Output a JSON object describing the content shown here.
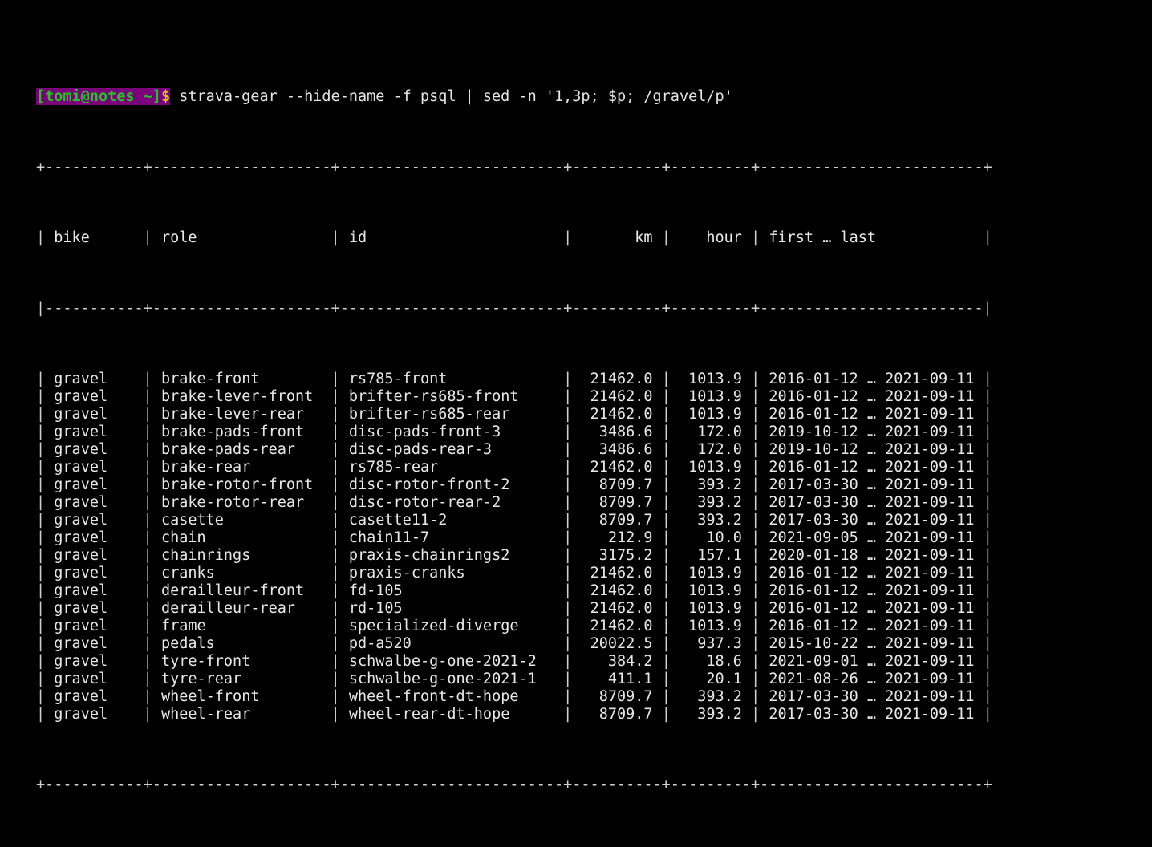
{
  "terminal": {
    "background_color": "#000000",
    "foreground_color": "#d8d8d8",
    "prompt_background_color": "#7b007b",
    "prompt_text_color": "#1fc61f",
    "prompt_dollar_color": "#cdcd00"
  },
  "prompt": {
    "user_host": "[tomi@notes ~]",
    "sigil": "$",
    "command": "strava-gear --hide-name -f psql | sed -n '1,3p; $p; /gravel/p'"
  },
  "table": {
    "top_border": "+-----------+--------------------+-------------------------+----------+---------+-------------------------+",
    "header_sep": "|-----------+--------------------+-------------------------+----------+---------+-------------------------|",
    "bottom_border": "+-----------+--------------------+-------------------------+----------+---------+-------------------------+",
    "columns": [
      {
        "key": "bike",
        "label": "bike",
        "width": 9,
        "align": "left"
      },
      {
        "key": "role",
        "label": "role",
        "width": 18,
        "align": "left"
      },
      {
        "key": "id",
        "label": "id",
        "width": 23,
        "align": "left"
      },
      {
        "key": "km",
        "label": "km",
        "width": 8,
        "align": "right"
      },
      {
        "key": "hour",
        "label": "hour",
        "width": 7,
        "align": "right"
      },
      {
        "key": "range",
        "label": "first … last",
        "width": 23,
        "align": "left"
      }
    ],
    "rows": [
      {
        "bike": "gravel",
        "role": "brake-front",
        "id": "rs785-front",
        "km": "21462.0",
        "hour": "1013.9",
        "first": "2016-01-12",
        "last": "2021-09-11"
      },
      {
        "bike": "gravel",
        "role": "brake-lever-front",
        "id": "brifter-rs685-front",
        "km": "21462.0",
        "hour": "1013.9",
        "first": "2016-01-12",
        "last": "2021-09-11"
      },
      {
        "bike": "gravel",
        "role": "brake-lever-rear",
        "id": "brifter-rs685-rear",
        "km": "21462.0",
        "hour": "1013.9",
        "first": "2016-01-12",
        "last": "2021-09-11"
      },
      {
        "bike": "gravel",
        "role": "brake-pads-front",
        "id": "disc-pads-front-3",
        "km": "3486.6",
        "hour": "172.0",
        "first": "2019-10-12",
        "last": "2021-09-11"
      },
      {
        "bike": "gravel",
        "role": "brake-pads-rear",
        "id": "disc-pads-rear-3",
        "km": "3486.6",
        "hour": "172.0",
        "first": "2019-10-12",
        "last": "2021-09-11"
      },
      {
        "bike": "gravel",
        "role": "brake-rear",
        "id": "rs785-rear",
        "km": "21462.0",
        "hour": "1013.9",
        "first": "2016-01-12",
        "last": "2021-09-11"
      },
      {
        "bike": "gravel",
        "role": "brake-rotor-front",
        "id": "disc-rotor-front-2",
        "km": "8709.7",
        "hour": "393.2",
        "first": "2017-03-30",
        "last": "2021-09-11"
      },
      {
        "bike": "gravel",
        "role": "brake-rotor-rear",
        "id": "disc-rotor-rear-2",
        "km": "8709.7",
        "hour": "393.2",
        "first": "2017-03-30",
        "last": "2021-09-11"
      },
      {
        "bike": "gravel",
        "role": "casette",
        "id": "casette11-2",
        "km": "8709.7",
        "hour": "393.2",
        "first": "2017-03-30",
        "last": "2021-09-11"
      },
      {
        "bike": "gravel",
        "role": "chain",
        "id": "chain11-7",
        "km": "212.9",
        "hour": "10.0",
        "first": "2021-09-05",
        "last": "2021-09-11"
      },
      {
        "bike": "gravel",
        "role": "chainrings",
        "id": "praxis-chainrings2",
        "km": "3175.2",
        "hour": "157.1",
        "first": "2020-01-18",
        "last": "2021-09-11"
      },
      {
        "bike": "gravel",
        "role": "cranks",
        "id": "praxis-cranks",
        "km": "21462.0",
        "hour": "1013.9",
        "first": "2016-01-12",
        "last": "2021-09-11"
      },
      {
        "bike": "gravel",
        "role": "derailleur-front",
        "id": "fd-105",
        "km": "21462.0",
        "hour": "1013.9",
        "first": "2016-01-12",
        "last": "2021-09-11"
      },
      {
        "bike": "gravel",
        "role": "derailleur-rear",
        "id": "rd-105",
        "km": "21462.0",
        "hour": "1013.9",
        "first": "2016-01-12",
        "last": "2021-09-11"
      },
      {
        "bike": "gravel",
        "role": "frame",
        "id": "specialized-diverge",
        "km": "21462.0",
        "hour": "1013.9",
        "first": "2016-01-12",
        "last": "2021-09-11"
      },
      {
        "bike": "gravel",
        "role": "pedals",
        "id": "pd-a520",
        "km": "20022.5",
        "hour": "937.3",
        "first": "2015-10-22",
        "last": "2021-09-11"
      },
      {
        "bike": "gravel",
        "role": "tyre-front",
        "id": "schwalbe-g-one-2021-2",
        "km": "384.2",
        "hour": "18.6",
        "first": "2021-09-01",
        "last": "2021-09-11"
      },
      {
        "bike": "gravel",
        "role": "tyre-rear",
        "id": "schwalbe-g-one-2021-1",
        "km": "411.1",
        "hour": "20.1",
        "first": "2021-08-26",
        "last": "2021-09-11"
      },
      {
        "bike": "gravel",
        "role": "wheel-front",
        "id": "wheel-front-dt-hope",
        "km": "8709.7",
        "hour": "393.2",
        "first": "2017-03-30",
        "last": "2021-09-11"
      },
      {
        "bike": "gravel",
        "role": "wheel-rear",
        "id": "wheel-rear-dt-hope",
        "km": "8709.7",
        "hour": "393.2",
        "first": "2017-03-30",
        "last": "2021-09-11"
      }
    ],
    "range_separator": "…"
  }
}
